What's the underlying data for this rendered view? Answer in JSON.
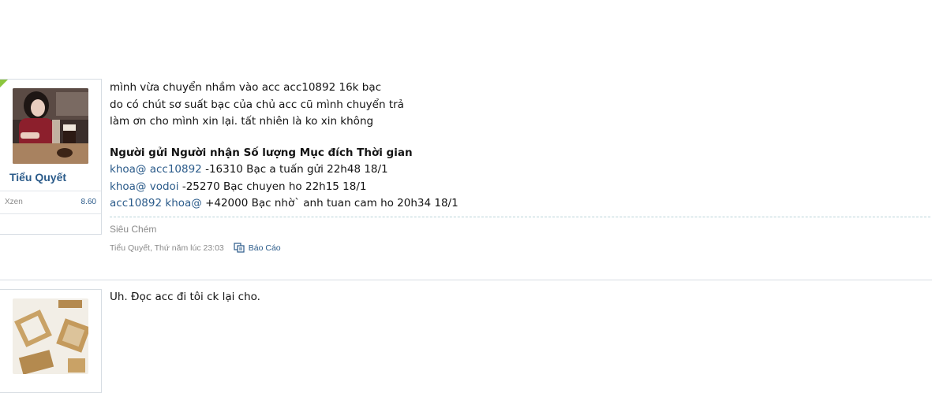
{
  "posts": [
    {
      "user": {
        "name": "Tiểu Quyết",
        "stat_label": "Xzen",
        "stat_value": "8.60"
      },
      "lines": [
        "mình vừa chuyển nhầm vào acc acc10892 16k bạc",
        "do có chút sơ suất bạc của chủ acc cũ mình chuyển trả",
        "làm ơn cho mình xin lại. tất nhiên là ko xin không"
      ],
      "table_header": "Người gửi Người nhận Số lượng Mục đích Thời gian",
      "rows": [
        {
          "sender": "khoa@",
          "receiver": "acc10892",
          "rest": " -16310 Bạc a tuấn gửi 22h48 18/1"
        },
        {
          "sender": "khoa@",
          "receiver": "vodoi",
          "rest": " -25270 Bạc chuyen ho 22h15 18/1"
        },
        {
          "sender": "acc10892",
          "receiver": "khoa@",
          "rest": " +42000 Bạc nhờ` anh tuan cam ho 20h34 18/1"
        }
      ],
      "signature": "Siêu Chém",
      "meta": "Tiểu Quyết, Thứ năm lúc 23:03",
      "report_label": "Báo Cáo"
    },
    {
      "text": "Uh. Đọc acc đi tôi ck lại cho."
    }
  ],
  "icons": {
    "report": "report-icon"
  },
  "colors": {
    "link": "#2b5b8a",
    "corner": "#8cc63e",
    "muted": "#8a8a8a"
  }
}
